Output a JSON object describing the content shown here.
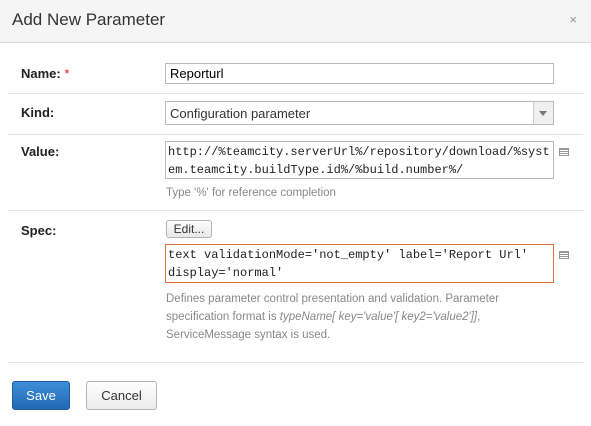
{
  "dialog": {
    "title": "Add New Parameter",
    "close_icon": "×"
  },
  "fields": {
    "name": {
      "label": "Name:",
      "required_mark": "*",
      "value": "Reporturl"
    },
    "kind": {
      "label": "Kind:",
      "selected": "Configuration parameter"
    },
    "value": {
      "label": "Value:",
      "text": "http://%teamcity.serverUrl%/repository/download/%system.teamcity.buildType.id%/%build.number%/",
      "hint": "Type '%' for reference completion"
    },
    "spec": {
      "label": "Spec:",
      "edit_button": "Edit...",
      "text": "text validationMode='not_empty' label='Report Url' display='normal'",
      "hint_part1": "Defines parameter control presentation and validation. Parameter specification format is ",
      "hint_format": "typeName[ key='value'[ key2='value2']]",
      "hint_part2": ", ServiceMessage syntax is used."
    }
  },
  "footer": {
    "save_label": "Save",
    "cancel_label": "Cancel"
  },
  "icons": {
    "value_side_icon": "text-editor-icon",
    "spec_side_icon": "text-editor-icon"
  },
  "colors": {
    "primary_button": "#2a76c6",
    "invalid_border": "#e0703c",
    "required": "#dd2222"
  }
}
